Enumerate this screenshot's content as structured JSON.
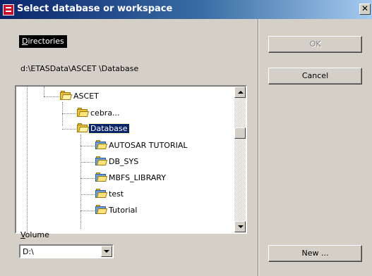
{
  "window": {
    "title": "Select database or workspace",
    "close_glyph": "✕"
  },
  "directories": {
    "label_accel": "D",
    "label_rest": "irectories",
    "path": "d:\\ETASData\\ASCET    \\Database"
  },
  "tree": {
    "items": [
      {
        "label": "ASCET",
        "icon": "folder-open-icon"
      },
      {
        "label": "cebra...",
        "icon": "folder-icon"
      },
      {
        "label": "Database",
        "icon": "folder-open-icon",
        "selected": true
      },
      {
        "label": "AUTOSAR TUTORIAL",
        "icon": "database-folder-icon"
      },
      {
        "label": "DB_SYS",
        "icon": "database-folder-icon"
      },
      {
        "label": "MBFS_LIBRARY",
        "icon": "database-folder-icon"
      },
      {
        "label": "test",
        "icon": "database-folder-icon"
      },
      {
        "label": "Tutorial",
        "icon": "database-folder-icon"
      }
    ]
  },
  "volume": {
    "label_accel": "V",
    "label_rest": "olume",
    "value": "D:\\"
  },
  "buttons": {
    "ok": "OK",
    "cancel": "Cancel",
    "new": "New ..."
  }
}
